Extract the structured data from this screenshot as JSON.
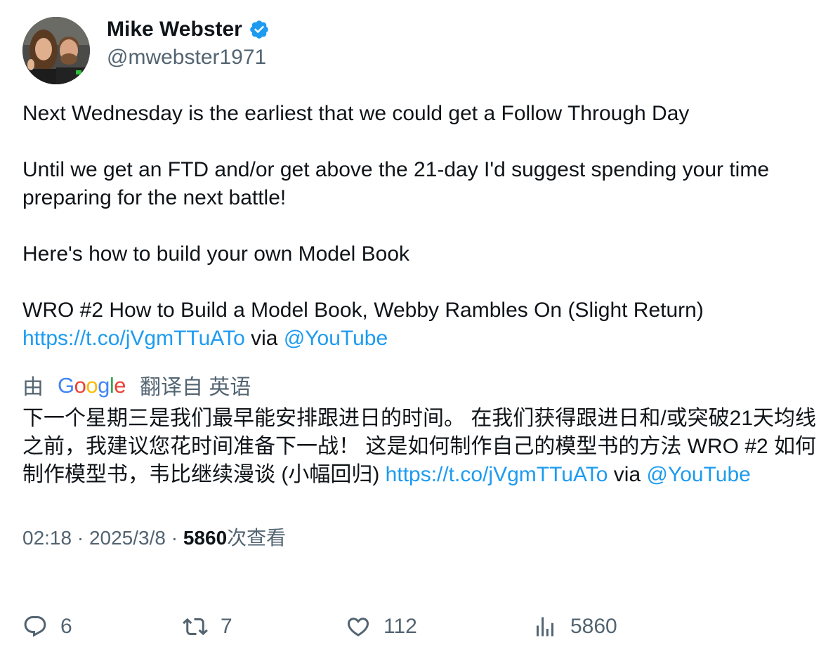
{
  "user": {
    "display_name": "Mike Webster",
    "handle": "@mwebster1971",
    "verified_icon": "verified-badge-icon",
    "verified_color": "#1d9bf0"
  },
  "tweet": {
    "line1": "Next Wednesday is the earliest that we could get a Follow Through Day",
    "line2": "Until we get an FTD and/or get above the 21-day I'd suggest spending your time preparing for the next battle!",
    "line3": "Here's how to build your own Model Book",
    "line4": "WRO #2 How to Build a Model Book, Webby Rambles On (Slight Return)",
    "link": "https://t.co/jVgmTTuATo",
    "via": "via",
    "mention": "@YouTube"
  },
  "translation": {
    "prefix": "由",
    "brand": "Google",
    "suffix": "翻译自 英语",
    "text": "下一个星期三是我们最早能安排跟进日的时间。 在我们获得跟进日和/或突破21天均线之前，我建议您花时间准备下一战！ 这是如何制作自己的模型书的方法 WRO #2 如何制作模型书，韦比继续漫谈 (小幅回归)",
    "link": "https://t.co/jVgmTTuATo",
    "via": "via",
    "mention": "@YouTube"
  },
  "meta": {
    "time": "02:18",
    "sep": " · ",
    "date": "2025/3/8",
    "views_count": "5860",
    "views_label": "次查看"
  },
  "actions": {
    "replies": "6",
    "retweets": "7",
    "likes": "112",
    "views": "5860"
  },
  "colors": {
    "link": "#1d9bf0",
    "text": "#0f1419",
    "secondary": "#536471"
  }
}
